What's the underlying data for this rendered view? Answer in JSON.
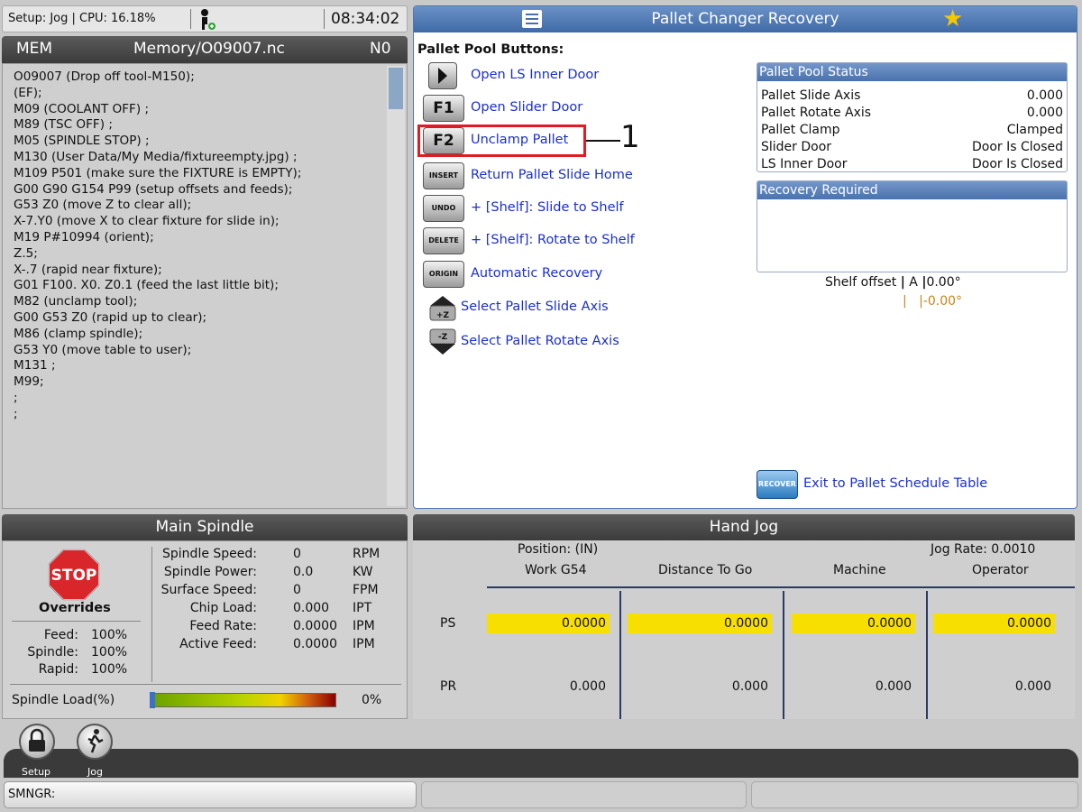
{
  "status": {
    "mode": "Setup: Jog | CPU: 16.18%",
    "time": "08:34:02"
  },
  "program": {
    "mem": "MEM",
    "path": "Memory/O09007.nc",
    "line": "N0",
    "lines": [
      "O09007 (Drop off tool-M150);",
      "(EF);",
      "M09 (COOLANT OFF) ;",
      "M89 (TSC OFF) ;",
      "M05 (SPINDLE STOP) ;",
      "M130 (User Data/My Media/fixtureempty.jpg) ;",
      "M109 P501 (make sure the FIXTURE is EMPTY);",
      "G00 G90 G154 P99 (setup offsets and feeds);",
      "G53 Z0 (move Z to clear all);",
      "X-7.Y0 (move X to clear fixture for slide in);",
      "M19 P#10994 (orient);",
      "Z.5;",
      "X-.7 (rapid near fixture);",
      "G01 F100. X0. Z0.1 (feed the last little bit);",
      "M82 (unclamp tool);",
      "G00 G53 Z0 (rapid up to clear);",
      "M86 (clamp spindle);",
      "G53 Y0 (move table to user);",
      "M131 ;",
      "M99;",
      ";",
      ";"
    ]
  },
  "recovery": {
    "title": "Pallet Changer Recovery",
    "pool_label": "Pallet Pool Buttons:",
    "buttons": [
      {
        "key": "",
        "label": "Open LS Inner Door"
      },
      {
        "key": "F1",
        "label": "Open Slider Door"
      },
      {
        "key": "F2",
        "label": "Unclamp Pallet"
      },
      {
        "key": "INSERT",
        "label": "Return Pallet Slide Home"
      },
      {
        "key": "UNDO",
        "label": "+ [Shelf]: Slide to Shelf"
      },
      {
        "key": "DELETE",
        "label": "+ [Shelf]: Rotate to Shelf"
      },
      {
        "key": "ORIGIN",
        "label": "Automatic Recovery"
      },
      {
        "key": "+Z",
        "label": "Select Pallet Slide Axis"
      },
      {
        "key": "-Z",
        "label": "Select Pallet Rotate Axis"
      }
    ],
    "callout": "1",
    "pool_status": {
      "title": "Pallet Pool Status",
      "rows": [
        {
          "label": "Pallet Slide Axis",
          "value": "0.000"
        },
        {
          "label": "Pallet Rotate Axis",
          "value": "0.000"
        },
        {
          "label": "Pallet Clamp",
          "value": "Clamped"
        },
        {
          "label": "Slider Door",
          "value": "Door Is Closed"
        },
        {
          "label": "LS Inner Door",
          "value": "Door Is Closed"
        }
      ]
    },
    "recovery_required": "Recovery Required",
    "shelf_offset": {
      "label": "Shelf offset",
      "axis": "A",
      "value": "0.00°",
      "value2": "-0.00°"
    },
    "exit": {
      "key": "RECOVER",
      "label": "Exit to Pallet Schedule Table"
    }
  },
  "spindle": {
    "title": "Main Spindle",
    "stop": "STOP",
    "overrides": "Overrides",
    "override_rows": [
      {
        "label": "Feed:",
        "value": "100%"
      },
      {
        "label": "Spindle:",
        "value": "100%"
      },
      {
        "label": "Rapid:",
        "value": "100%"
      }
    ],
    "rows": [
      {
        "label": "Spindle Speed:",
        "value": "0",
        "unit": "RPM"
      },
      {
        "label": "Spindle Power:",
        "value": "0.0",
        "unit": "KW"
      },
      {
        "label": "Surface Speed:",
        "value": "0",
        "unit": "FPM"
      },
      {
        "label": "Chip Load:",
        "value": "0.000",
        "unit": "IPT"
      },
      {
        "label": "Feed Rate:",
        "value": "0.0000",
        "unit": "IPM"
      },
      {
        "label": "Active Feed:",
        "value": "0.0000",
        "unit": "IPM"
      }
    ],
    "load_label": "Spindle Load(%)",
    "load_value": "0%",
    "load_fraction": 0
  },
  "jog": {
    "title": "Hand Jog",
    "position_label": "Position: (IN)",
    "jog_rate": "Jog Rate: 0.0010",
    "columns": [
      "Work G54",
      "Distance To Go",
      "Machine",
      "Operator"
    ],
    "rows": [
      {
        "axis": "PS",
        "values": [
          "0.0000",
          "0.0000",
          "0.0000",
          "0.0000"
        ]
      },
      {
        "axis": "PR",
        "values": [
          "0.000",
          "0.000",
          "0.000",
          "0.000"
        ]
      }
    ]
  },
  "tabs": [
    {
      "label": "Setup"
    },
    {
      "label": "Jog"
    }
  ],
  "command": {
    "label": "SMNGR:"
  }
}
